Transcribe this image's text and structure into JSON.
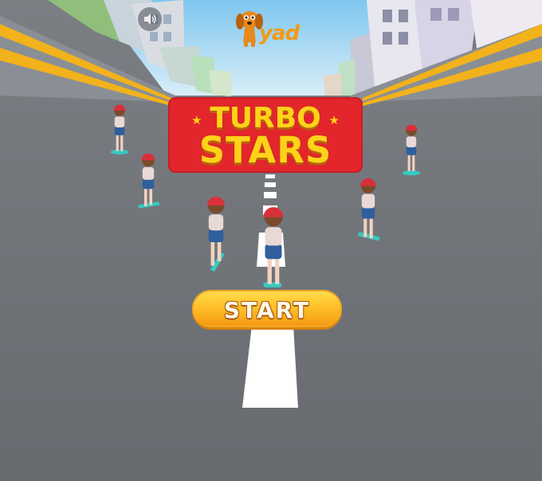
{
  "game": {
    "title_line_1": "TURBO",
    "title_line_2": "STARS",
    "start_label": "START",
    "sound_state": "on"
  },
  "branding": {
    "logo_text": "yad"
  },
  "colors": {
    "road": "#6b6f74",
    "lane_stripes": "#f2b21b",
    "title_panel": "#e2262b",
    "title_text": "#ffd21a",
    "start_button": "#ffc12a",
    "skateboard": "#37c9c2",
    "helmet": "#d8303a"
  },
  "icons": {
    "sound": "speaker-icon",
    "logo": "dog-mascot-icon",
    "title_stars": "star-icon"
  }
}
